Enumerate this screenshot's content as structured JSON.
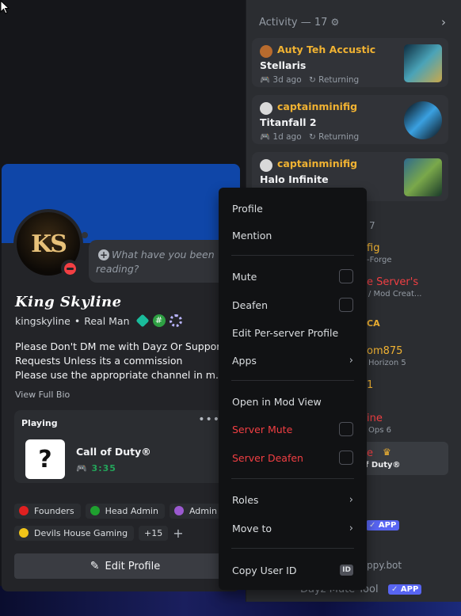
{
  "activity": {
    "title": "Activity — 17",
    "cards": [
      {
        "user": "Auty Teh Accustic",
        "game": "Stellaris",
        "time": "3d ago",
        "status": "Returning",
        "avatar_color": "#b86b2e",
        "thumb_colors": [
          "#0d2b3e",
          "#4aa3b8",
          "#c9a84a"
        ]
      },
      {
        "user": "captainminifig",
        "game": "Titanfall 2",
        "time": "1d ago",
        "status": "Returning",
        "avatar_color": "#d9d9d9",
        "thumb_colors": [
          "#050608",
          "#3aa0e0",
          "#0a0c10"
        ]
      },
      {
        "user": "captainminifig",
        "game": "Halo Infinite",
        "time": "",
        "status": "",
        "avatar_color": "#d9d9d9",
        "thumb_colors": [
          "#2e6a8c",
          "#7aa84a",
          "#1a3a2a"
        ]
      }
    ]
  },
  "member_list_fragments": [
    {
      "text": "7",
      "color": "#949ba4"
    },
    {
      "text": "fig",
      "color": "#f0b232"
    },
    {
      "text": "-Forge",
      "color": "#949ba4"
    },
    {
      "text": "e Server's",
      "color": "#f23f43"
    },
    {
      "text": "/ Mod Creat...",
      "color": "#949ba4"
    },
    {
      "text": "CA",
      "color": "#f0b232"
    },
    {
      "text": "om875",
      "color": "#f0b232"
    },
    {
      "text": "Horizon 5",
      "color": "#949ba4"
    },
    {
      "text": "1",
      "color": "#f0b232"
    },
    {
      "text": "ine",
      "color": "#f23f43"
    },
    {
      "text": "Ops 6",
      "color": "#949ba4"
    },
    {
      "text": "e",
      "color": "#f23f43"
    },
    {
      "text": "f Duty®",
      "color": "#f2f3f5"
    },
    {
      "text": "APP",
      "color": "#ffffff"
    },
    {
      "text": "ppy.bot",
      "color": "#949ba4"
    },
    {
      "text": "Dayz Mute Tool",
      "color": "#949ba4"
    },
    {
      "text": "APP",
      "color": "#ffffff"
    }
  ],
  "profile": {
    "avatar_text": "KS",
    "status_prompt": "What have you been reading?",
    "display_name": "King Skyline",
    "username": "kingskyline",
    "pronouns": "Real Man",
    "bio_lines": [
      "Please Don't DM me with Dayz Or Support",
      "Requests Unless its a commission",
      "Please use the appropriate channel in my ..."
    ],
    "view_bio": "View Full Bio",
    "playing_label": "Playing",
    "game": {
      "name": "Call of Duty®",
      "elapsed": "3:35",
      "icon_glyph": "?"
    },
    "roles": [
      {
        "name": "Founders",
        "color": "#e02020"
      },
      {
        "name": "Head Admin",
        "color": "#1fa12f"
      },
      {
        "name": "Admin",
        "color": "#9b59d0"
      },
      {
        "name": "Devils House Gaming",
        "color": "#f0c419"
      }
    ],
    "roles_more": "+15",
    "edit_button": "Edit Profile"
  },
  "menu": {
    "items": [
      {
        "label": "Profile"
      },
      {
        "label": "Mention"
      },
      {
        "label": "Mute",
        "control": "checkbox",
        "checked": false
      },
      {
        "label": "Deafen",
        "control": "checkbox",
        "checked": false
      },
      {
        "label": "Edit Per-server Profile"
      },
      {
        "label": "Apps",
        "control": "submenu"
      },
      {
        "label": "Open in Mod View"
      },
      {
        "label": "Server Mute",
        "control": "checkbox",
        "checked": false,
        "danger": true
      },
      {
        "label": "Server Deafen",
        "control": "checkbox",
        "checked": false,
        "danger": true
      },
      {
        "label": "Roles",
        "control": "submenu"
      },
      {
        "label": "Move to",
        "control": "submenu"
      },
      {
        "label": "Copy User ID",
        "control": "id-badge",
        "badge": "ID"
      }
    ]
  },
  "colors": {
    "accent": "#5865f2",
    "banner": "#0f46a8",
    "danger": "#f23f43",
    "online_game": "#23a55a",
    "username_gold": "#f0b232"
  }
}
